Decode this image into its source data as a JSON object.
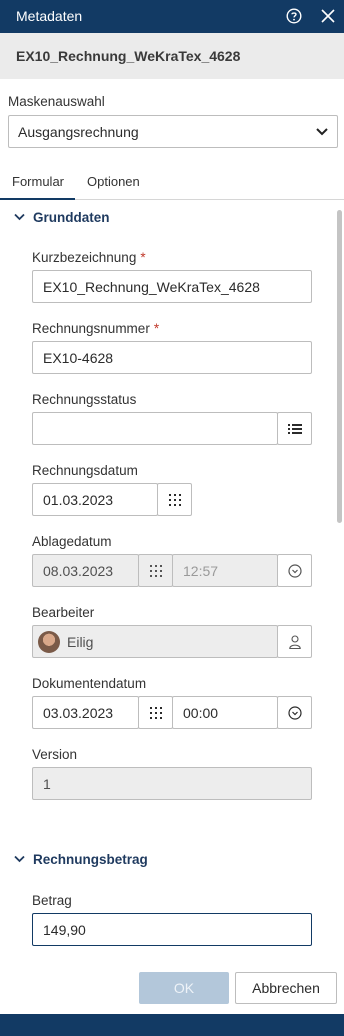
{
  "window": {
    "title": "Metadaten",
    "help_icon": "help-circle-icon",
    "close_icon": "close-icon"
  },
  "document": {
    "name": "EX10_Rechnung_WeKraTex_4628"
  },
  "mask": {
    "label": "Maskenauswahl",
    "selected": "Ausgangsrechnung"
  },
  "tabs": [
    {
      "label": "Formular",
      "active": true
    },
    {
      "label": "Optionen",
      "active": false
    }
  ],
  "sections": {
    "grunddaten": {
      "title": "Grunddaten"
    },
    "rechnungsbetrag": {
      "title": "Rechnungsbetrag"
    }
  },
  "fields": {
    "kurzbezeichnung": {
      "label": "Kurzbezeichnung",
      "required_mark": "*",
      "value": "EX10_Rechnung_WeKraTex_4628"
    },
    "rechnungsnummer": {
      "label": "Rechnungsnummer",
      "required_mark": "*",
      "value": "EX10-4628"
    },
    "rechnungsstatus": {
      "label": "Rechnungsstatus",
      "value": ""
    },
    "rechnungsdatum": {
      "label": "Rechnungsdatum",
      "value": "01.03.2023"
    },
    "ablagedatum": {
      "label": "Ablagedatum",
      "date": "08.03.2023",
      "time": "12:57"
    },
    "bearbeiter": {
      "label": "Bearbeiter",
      "value": "Eilig"
    },
    "dokumentendatum": {
      "label": "Dokumentendatum",
      "date": "03.03.2023",
      "time": "00:00"
    },
    "version": {
      "label": "Version",
      "value": "1"
    },
    "betrag": {
      "label": "Betrag",
      "value": "149,90"
    }
  },
  "buttons": {
    "ok": "OK",
    "cancel": "Abbrechen"
  },
  "colors": {
    "header": "#123a64",
    "ok_disabled": "#b3c7da",
    "required": "#c0392b"
  }
}
